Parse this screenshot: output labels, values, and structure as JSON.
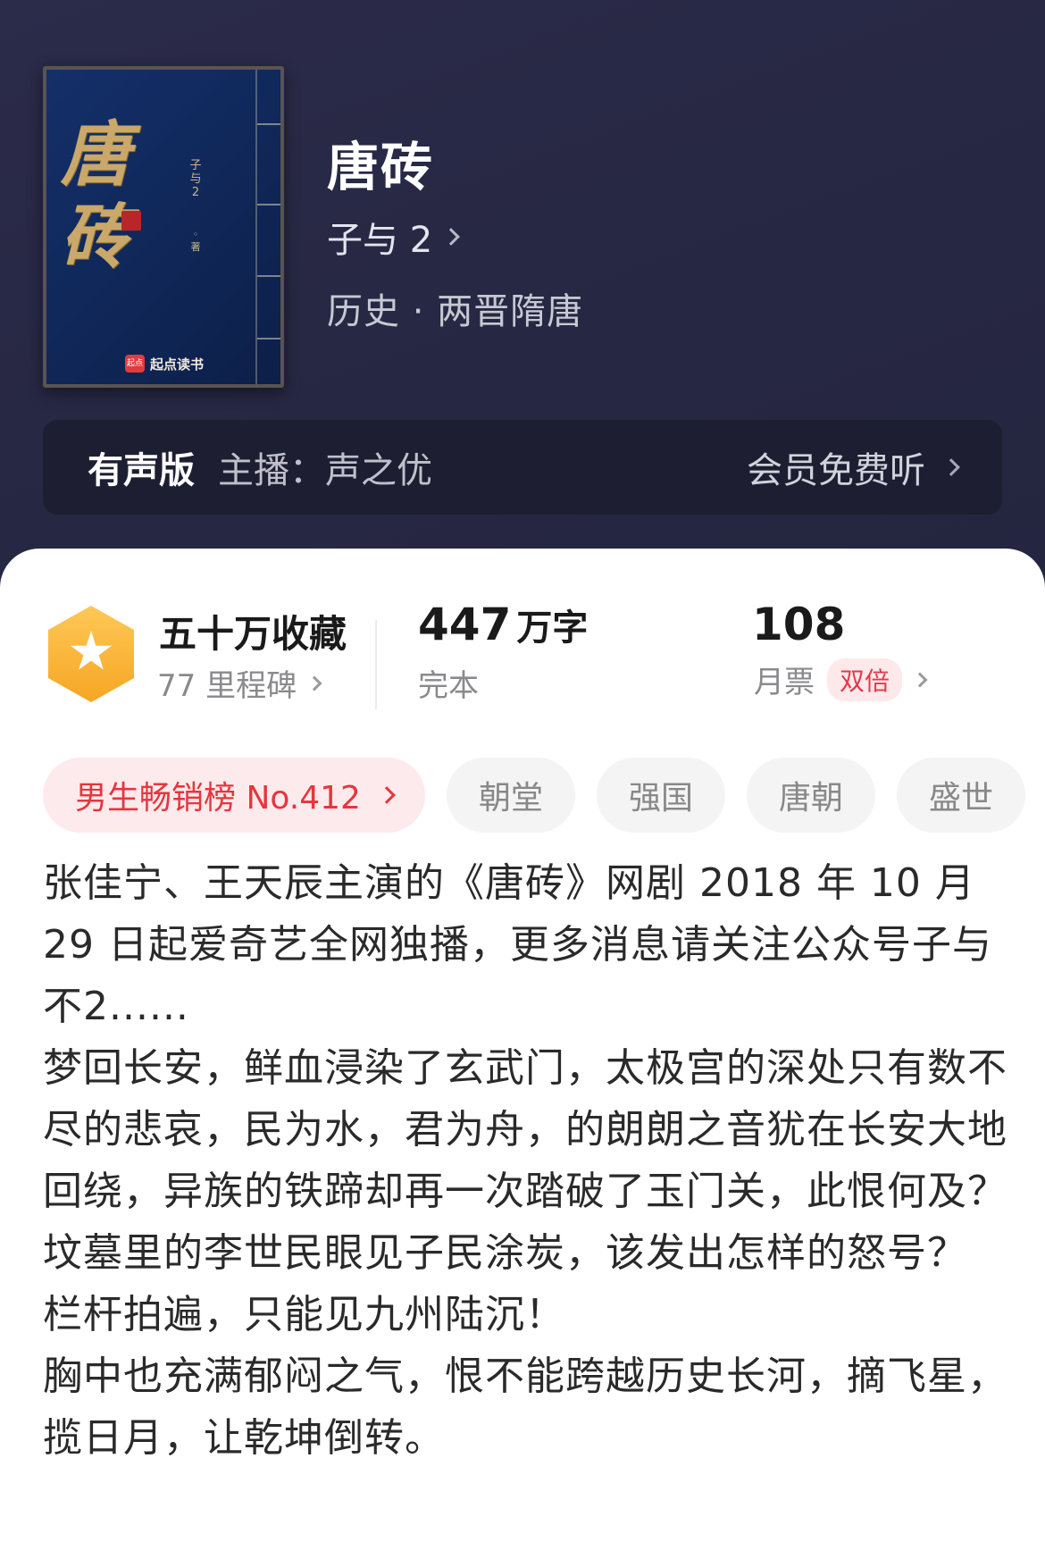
{
  "book": {
    "title": "唐砖",
    "author": "子与 2",
    "genre": "历史 · 两晋隋唐",
    "cover": {
      "title_text": "唐砖",
      "author_text": "子与2",
      "author_suffix": "◦ 著",
      "publisher_badge": "起点",
      "publisher": "起点读书"
    }
  },
  "audio": {
    "tag": "有声版",
    "host": "主播：声之优",
    "vip_label": "会员免费听"
  },
  "stats": {
    "collect_main": "五十万收藏",
    "collect_sub": "77 里程碑",
    "words_num": "447",
    "words_unit": "万字",
    "status": "完本",
    "ticket_num": "108",
    "ticket_label": "月票",
    "ticket_tag": "双倍"
  },
  "tags": {
    "rank": "男生畅销榜 No.412",
    "items": [
      "朝堂",
      "强国",
      "唐朝",
      "盛世"
    ]
  },
  "description": [
    "张佳宁、王天辰主演的《唐砖》网剧 2018 年 10 月 29 日起爱奇艺全网独播，更多消息请关注公众号子与不2......",
    "梦回长安，鲜血浸染了玄武门，太极宫的深处只有数不尽的悲哀，民为水，君为舟，的朗朗之音犹在长安大地回绕，异族的铁蹄却再一次踏破了玉门关，此恨何及？",
    "坟墓里的李世民眼见子民涂炭，该发出怎样的怒号？",
    "栏杆拍遍，只能见九州陆沉！",
    "胸中也充满郁闷之气，恨不能跨越历史长河，摘飞星，揽日月，让乾坤倒转。"
  ],
  "colors": {
    "header_bg": "#272844",
    "accent_red": "#e5363e",
    "badge_orange": "#f5a623"
  }
}
